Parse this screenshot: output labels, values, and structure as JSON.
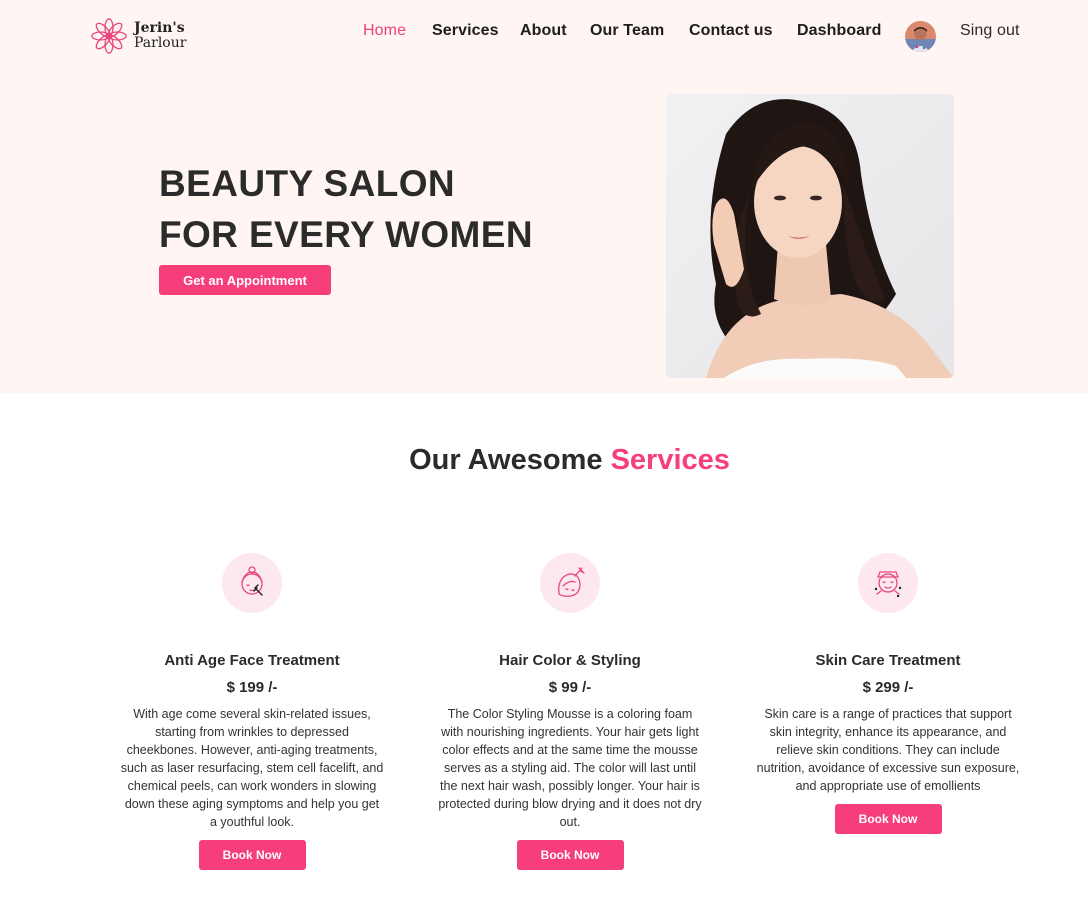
{
  "brand": {
    "name_line1": "Jerin's",
    "name_line2": "Parlour",
    "accent_color": "#f63e7b"
  },
  "nav": {
    "items": [
      "Home",
      "Services",
      "About",
      "Our Team",
      "Contact us",
      "Dashboard"
    ],
    "active": "Home",
    "signout_label": "Sing out"
  },
  "hero": {
    "title_line1": "BEAUTY SALON",
    "title_line2": "FOR EVERY WOMEN",
    "cta_label": "Get an Appointment"
  },
  "services": {
    "heading_prefix": "Our Awesome",
    "heading_accent": "Services",
    "cards": [
      {
        "icon": "face-treatment-icon",
        "title": "Anti Age Face Treatment",
        "price": "$ 199 /-",
        "description": "With age come several skin-related issues, starting from wrinkles to depressed cheekbones. However, anti-aging treatments, such as laser resurfacing, stem cell facelift, and chemical peels, can work wonders in slowing down these aging symptoms and help you get a youthful look.",
        "button_label": "Book Now"
      },
      {
        "icon": "hair-styling-icon",
        "title": "Hair Color & Styling",
        "price": "$ 99 /-",
        "description": "The Color Styling Mousse is a coloring foam with nourishing ingredients. Your hair gets light color effects and at the same time the mousse serves as a styling aid. The color will last until the next hair wash, possibly longer. Your hair is protected during blow drying and it does not dry out.",
        "button_label": "Book Now"
      },
      {
        "icon": "skin-care-icon",
        "title": "Skin Care Treatment",
        "price": "$ 299 /-",
        "description": "Skin care is a range of practices that support skin integrity, enhance its appearance, and relieve skin conditions. They can include nutrition, avoidance of excessive sun exposure, and appropriate use of emollients",
        "button_label": "Book Now"
      }
    ]
  }
}
